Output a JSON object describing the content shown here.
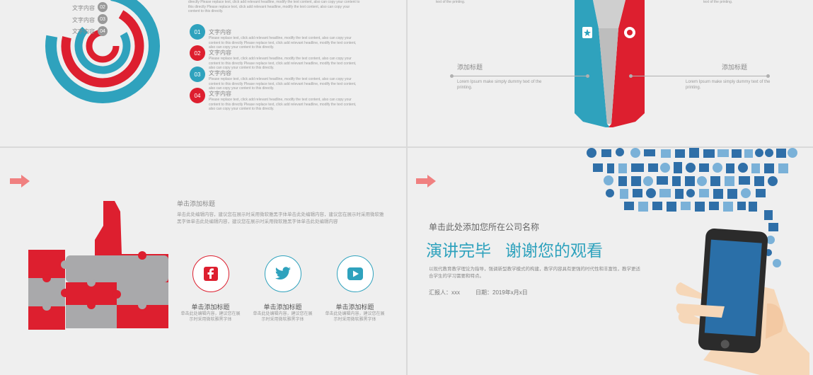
{
  "panel1": {
    "ring_labels": [
      "文字内容",
      "文字内容",
      "文字内容"
    ],
    "ring_badges": [
      "02",
      "03",
      "04"
    ],
    "top_text": "directly Please replace text, click add relevant headline, modify the text content, also can copy your content to this directly Please replace text, click add relevant headline, modify the text content, also can copy your content to this directly.",
    "items": [
      {
        "num": "01",
        "title": "文字内容",
        "desc": "Please replace text, click add relevant headline, modify the text content, also can copy your content to this directly Please replace text, click add relevant headline, modify the text content, also can copy your content to this directly."
      },
      {
        "num": "02",
        "title": "文字内容",
        "desc": "Please replace text, click add relevant headline, modify the text content, also can copy your content to this directly Please replace text, click add relevant headline, modify the text content, also can copy your content to this directly."
      },
      {
        "num": "03",
        "title": "文字内容",
        "desc": "Please replace text, click add relevant headline, modify the text content, also can copy your content to this directly Please replace text, click add relevant headline, modify the text content, also can copy your content to this directly."
      },
      {
        "num": "04",
        "title": "文字内容",
        "desc": "Please replace text, click add relevant headline, modify the text content, also can copy your content to this directly Please replace text, click add relevant headline, modify the text content, also can copy your content to this directly."
      }
    ]
  },
  "panel2": {
    "top_left": "text of the printing.",
    "top_right": "text of the printing.",
    "left_title": "添加标题",
    "left_desc": "Lorem Ipsum make simply dummy text of the printing.",
    "right_title": "添加标题",
    "right_desc": "Lorem Ipsum make simply dummy text of the printing."
  },
  "panel3": {
    "heading": "单击添加标题",
    "paragraph": "单击此处编辑内容，建议您在展示时采用微软雅黑字体单击此处编辑内容，建议您在展示时采用微软雅黑字体单击此处编辑内容，建议您在展示时采用微软雅黑字体单击此处编辑内容",
    "socials": [
      {
        "icon": "facebook-icon",
        "title": "单击添加标题",
        "desc": "单击此处编辑内容，建议您在展示时采用微软雅黑字体",
        "color": "#dd1f2f"
      },
      {
        "icon": "twitter-icon",
        "title": "单击添加标题",
        "desc": "单击此处编辑内容，建议您在展示时采用微软雅黑字体",
        "color": "#2fa2bd"
      },
      {
        "icon": "youtube-icon",
        "title": "单击添加标题",
        "desc": "单击此处编辑内容，建议您在展示时采用微软雅黑字体",
        "color": "#2fa2bd"
      }
    ]
  },
  "panel4": {
    "company": "单击此处添加您所在公司名称",
    "title_part1": "演讲完毕",
    "title_part2": "谢谢您的观看",
    "desc": "以现代教育教学理论为指导，强调新型教学模式的构建，教学内容具有更强的时代性和丰富性，教学更适合学生的学习需要和特点。",
    "reporter": "汇报人：xxx",
    "date": "日期：2019年x月x日"
  },
  "colors": {
    "red": "#dd1f2f",
    "blue": "#2fa2bd",
    "gray": "#a9a9ab",
    "arrow": "#f08080"
  }
}
